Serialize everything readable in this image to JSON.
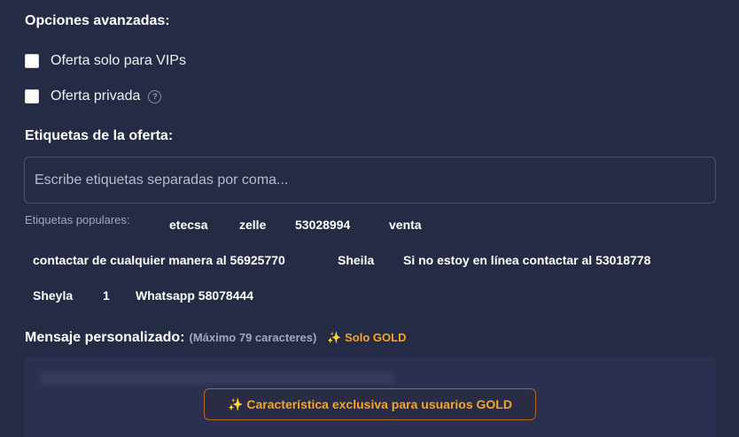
{
  "advanced": {
    "title": "Opciones avanzadas:",
    "vip_label": "Oferta solo para VIPs",
    "vip_checked": false,
    "private_label": "Oferta privada",
    "help_icon": "question-circle-icon",
    "help_glyph": "?",
    "private_checked": false
  },
  "tags": {
    "title": "Etiquetas de la oferta:",
    "placeholder": "Escribe etiquetas separadas por coma...",
    "popular_label": "Etiquetas populares:",
    "popular": [
      "etecsa",
      "zelle",
      "53028994",
      "venta",
      "contactar de cualquier manera al 56925770",
      "Sheila",
      "Si no estoy en línea contactar al 53018778",
      "Sheyla",
      "1",
      "Whatsapp 58078444"
    ]
  },
  "message": {
    "title": "Mensaje personalizado:",
    "limit_hint": "(Máximo 79 caracteres)",
    "gold_icon": "sparkles-icon",
    "gold_glyph": "✨",
    "gold_badge": "Solo GOLD",
    "gold_button": "Característica exclusiva para usuarios GOLD"
  },
  "colors": {
    "background": "#252a45",
    "gold": "#f5a623",
    "muted": "#a3a7bb"
  }
}
